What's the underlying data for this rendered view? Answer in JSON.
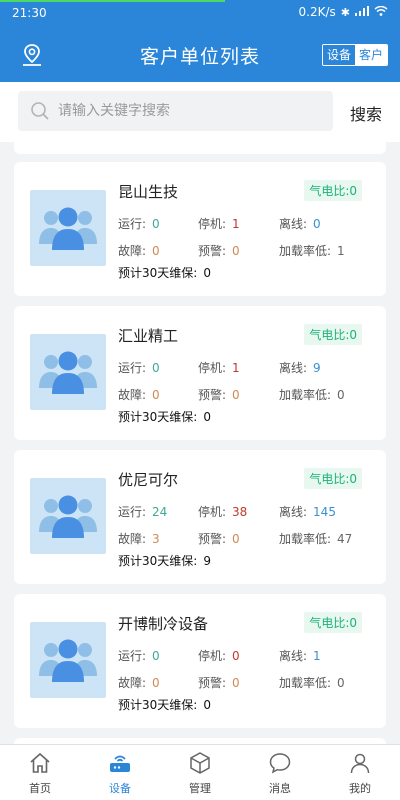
{
  "status": {
    "time": "21:30",
    "speed": "0.2K/s"
  },
  "header": {
    "title": "客户单位列表",
    "switch_off": "设备",
    "switch_on": "客户"
  },
  "search": {
    "placeholder": "请输入关键字搜索",
    "button": "搜索"
  },
  "labels": {
    "running": "运行:",
    "stopped": "停机:",
    "offline": "离线:",
    "fault": "故障:",
    "warning": "预警:",
    "low_load": "加载率低:",
    "maintenance": "预计30天维保:",
    "ratio": "气电比:"
  },
  "cards": [
    {
      "name": "昆山生技",
      "ratio": "0",
      "running": "0",
      "stopped": "1",
      "offline": "0",
      "fault": "0",
      "warning": "0",
      "low_load": "1",
      "maintenance": "0"
    },
    {
      "name": "汇业精工",
      "ratio": "0",
      "running": "0",
      "stopped": "1",
      "offline": "9",
      "fault": "0",
      "warning": "0",
      "low_load": "0",
      "maintenance": "0"
    },
    {
      "name": "优尼可尔",
      "ratio": "0",
      "running": "24",
      "stopped": "38",
      "offline": "145",
      "fault": "3",
      "warning": "0",
      "low_load": "47",
      "maintenance": "9"
    },
    {
      "name": "开博制冷设备",
      "ratio": "0",
      "running": "0",
      "stopped": "0",
      "offline": "1",
      "fault": "0",
      "warning": "0",
      "low_load": "0",
      "maintenance": "0"
    }
  ],
  "tabs": [
    {
      "label": "首页",
      "icon": "home-icon"
    },
    {
      "label": "设备",
      "icon": "router-icon"
    },
    {
      "label": "管理",
      "icon": "box-icon"
    },
    {
      "label": "消息",
      "icon": "chat-icon"
    },
    {
      "label": "我的",
      "icon": "person-icon"
    }
  ],
  "colors": {
    "primary": "#2b86d9",
    "ratio_green": "#19b37a"
  }
}
